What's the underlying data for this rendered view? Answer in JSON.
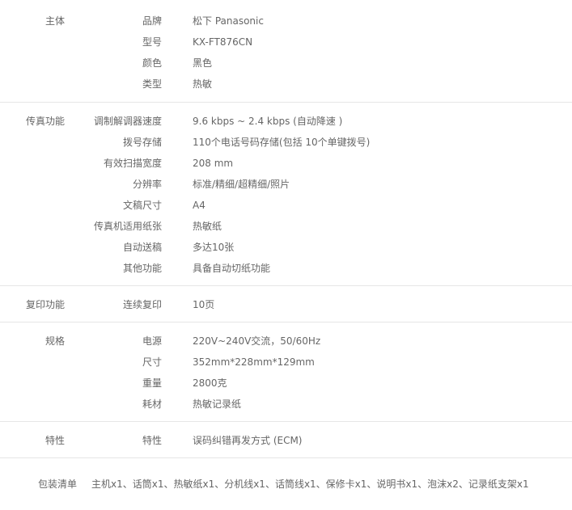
{
  "sections": [
    {
      "category": "主体",
      "rows": [
        {
          "label": "品牌",
          "value": "松下 Panasonic"
        },
        {
          "label": "型号",
          "value": "KX-FT876CN"
        },
        {
          "label": "颜色",
          "value": "黑色"
        },
        {
          "label": "类型",
          "value": "热敏"
        }
      ]
    },
    {
      "category": "传真功能",
      "rows": [
        {
          "label": "调制解调器速度",
          "value": "9.6 kbps ~ 2.4 kbps (自动降速 )"
        },
        {
          "label": "拨号存储",
          "value": "110个电话号码存储(包括 10个单键拨号)"
        },
        {
          "label": "有效扫描宽度",
          "value": "208 mm"
        },
        {
          "label": "分辨率",
          "value": "标准/精细/超精细/照片"
        },
        {
          "label": "文稿尺寸",
          "value": "A4"
        },
        {
          "label": "传真机适用纸张",
          "value": "热敏纸"
        },
        {
          "label": "自动送稿",
          "value": "多达10张"
        },
        {
          "label": "其他功能",
          "value": "具备自动切纸功能"
        }
      ]
    },
    {
      "category": "复印功能",
      "rows": [
        {
          "label": "连续复印",
          "value": "10页"
        }
      ]
    },
    {
      "category": "规格",
      "rows": [
        {
          "label": "电源",
          "value": "220V~240V交流，50/60Hz"
        },
        {
          "label": "尺寸",
          "value": "352mm*228mm*129mm"
        },
        {
          "label": "重量",
          "value": "2800克"
        },
        {
          "label": "耗材",
          "value": "热敏记录纸"
        }
      ]
    },
    {
      "category": "特性",
      "rows": [
        {
          "label": "特性",
          "value": "误码纠错再发方式 (ECM)"
        }
      ]
    }
  ],
  "package": {
    "label": "包装清单",
    "value": "主机x1、话筒x1、热敏纸x1、分机线x1、话筒线x1、保修卡x1、说明书x1、泡沫x2、记录纸支架x1"
  }
}
